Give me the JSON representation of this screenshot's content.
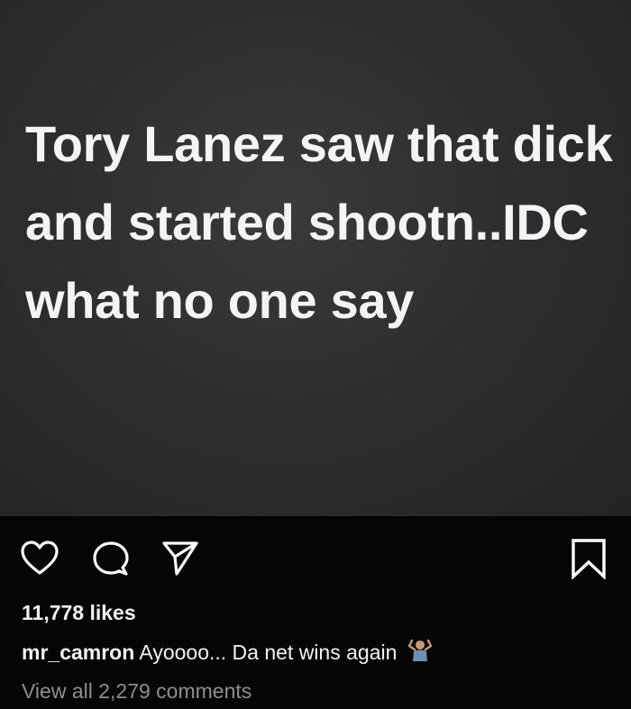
{
  "post": {
    "image_text": "Tory Lanez saw that dick and started shootn..IDC what no one say"
  },
  "actions": {
    "like_icon": "heart-icon",
    "comment_icon": "comment-icon",
    "share_icon": "send-icon",
    "save_icon": "bookmark-icon"
  },
  "likes": "11,778 likes",
  "caption": {
    "username": "mr_camron",
    "text": "Ayoooo... Da net wins again",
    "emoji": "person-shrugging-emoji"
  },
  "comments": {
    "view_all": "View all 2,279 comments"
  },
  "colors": {
    "background": "#050505",
    "image_background": "#2e2e30",
    "text_primary": "#f2f2f2",
    "text_secondary": "#8e8e8e"
  }
}
